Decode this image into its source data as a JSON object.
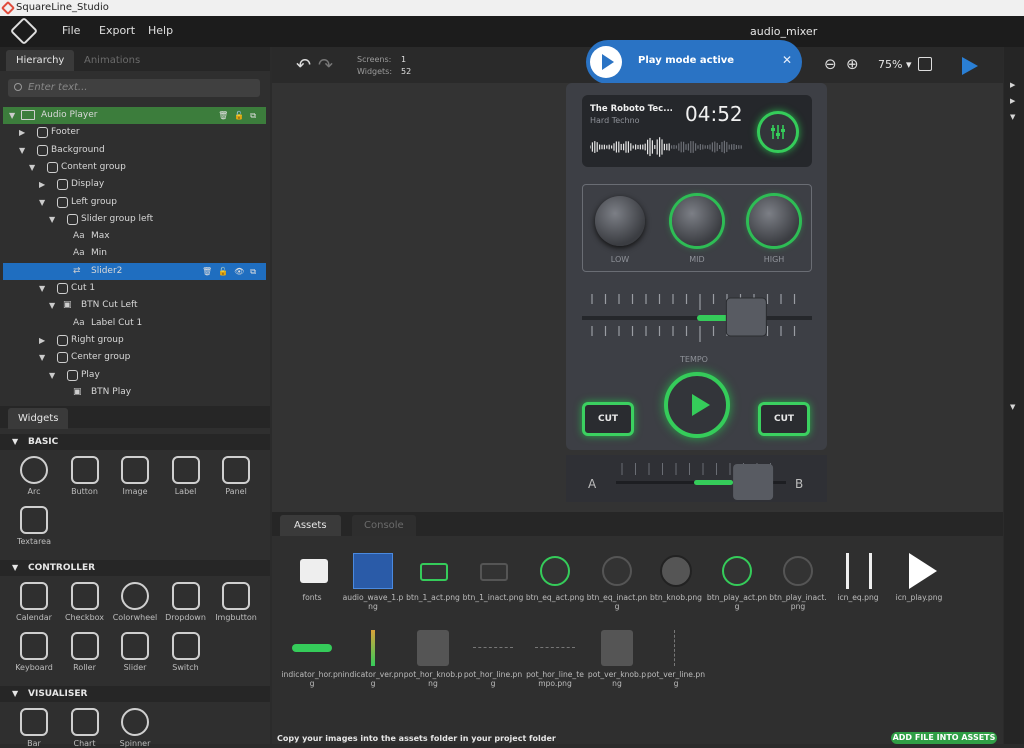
{
  "window": {
    "title": "SquareLine_Studio"
  },
  "menu": {
    "items": [
      "File",
      "Export",
      "Help"
    ],
    "project_name": "audio_mixer"
  },
  "hierarchy": {
    "tabs": [
      "Hierarchy",
      "Animations"
    ],
    "search_placeholder": "Enter text...",
    "rows": [
      {
        "label": "Audio Player",
        "level": 0,
        "arrow": "▼",
        "icon": "screen"
      },
      {
        "label": "Footer",
        "level": 1,
        "arrow": "▶",
        "icon": "box"
      },
      {
        "label": "Background",
        "level": 1,
        "arrow": "▼",
        "icon": "box"
      },
      {
        "label": "Content group",
        "level": 2,
        "arrow": "▼",
        "icon": "box"
      },
      {
        "label": "Display",
        "level": 3,
        "arrow": "▶",
        "icon": "box"
      },
      {
        "label": "Left group",
        "level": 3,
        "arrow": "▼",
        "icon": "box"
      },
      {
        "label": "Slider group left",
        "level": 4,
        "arrow": "▼",
        "icon": "box"
      },
      {
        "label": "Max",
        "level": 5,
        "arrow": "",
        "icon": "label"
      },
      {
        "label": "Min",
        "level": 5,
        "arrow": "",
        "icon": "label"
      },
      {
        "label": "Slider2",
        "level": 5,
        "arrow": "",
        "icon": "slider"
      },
      {
        "label": "Cut 1",
        "level": 3,
        "arrow": "▼",
        "icon": "box"
      },
      {
        "label": "BTN Cut Left",
        "level": 4,
        "arrow": "▼",
        "icon": "imgbutton"
      },
      {
        "label": "Label Cut 1",
        "level": 5,
        "arrow": "",
        "icon": "label"
      },
      {
        "label": "Right group",
        "level": 3,
        "arrow": "▶",
        "icon": "box"
      },
      {
        "label": "Center group",
        "level": 3,
        "arrow": "▼",
        "icon": "box"
      },
      {
        "label": "Play",
        "level": 4,
        "arrow": "▼",
        "icon": "box"
      },
      {
        "label": "BTN Play",
        "level": 5,
        "arrow": "",
        "icon": "imgbutton"
      }
    ]
  },
  "widgets": {
    "tab": "Widgets",
    "sections": [
      {
        "title": "BASIC",
        "items": [
          "Arc",
          "Button",
          "Image",
          "Label",
          "Panel",
          "Textarea"
        ]
      },
      {
        "title": "CONTROLLER",
        "items": [
          "Calendar",
          "Checkbox",
          "Colorwheel",
          "Dropdown",
          "Imgbutton",
          "Keyboard",
          "Roller",
          "Slider",
          "Switch"
        ]
      },
      {
        "title": "VISUALISER",
        "items": [
          "Bar",
          "Chart",
          "Spinner"
        ]
      }
    ]
  },
  "toolbar": {
    "screens_label": "Screens:",
    "screens_value": "1",
    "widgets_label": "Widgets:",
    "widgets_value": "52",
    "zoom": "75%"
  },
  "toast": {
    "message": "Play mode active"
  },
  "player": {
    "track_title": "The Roboto Tec...",
    "track_genre": "Hard Techno",
    "time": "04:52",
    "eq_labels": [
      "LOW",
      "MID",
      "HIGH"
    ],
    "tempo_label": "TEMPO",
    "tempo_fill": 0.6,
    "cut_left": "CUT",
    "cut_right": "CUT",
    "cross_a": "A",
    "cross_b": "B",
    "cross_fill": 0.6
  },
  "assets": {
    "tabs": [
      "Assets",
      "Console"
    ],
    "items": [
      "fonts",
      "audio_wave_1.png",
      "btn_1_act.png",
      "btn_1_inact.png",
      "btn_eq_act.png",
      "btn_eq_inact.png",
      "btn_knob.png",
      "btn_play_act.png",
      "btn_play_inact.png",
      "icn_eq.png",
      "icn_play.png",
      "indicator_hor.png",
      "indicator_ver.png",
      "pot_hor_knob.png",
      "pot_hor_line.png",
      "pot_hor_line_tempo.png",
      "pot_ver_knob.png",
      "pot_ver_line.png"
    ],
    "hint": "Copy your images into the assets folder in your project folder",
    "add_button": "ADD FILE INTO ASSETS"
  },
  "colors": {
    "accent_green": "#35cc5a",
    "selection_blue": "#1f6ec0",
    "toast_blue": "#2a73c4"
  }
}
